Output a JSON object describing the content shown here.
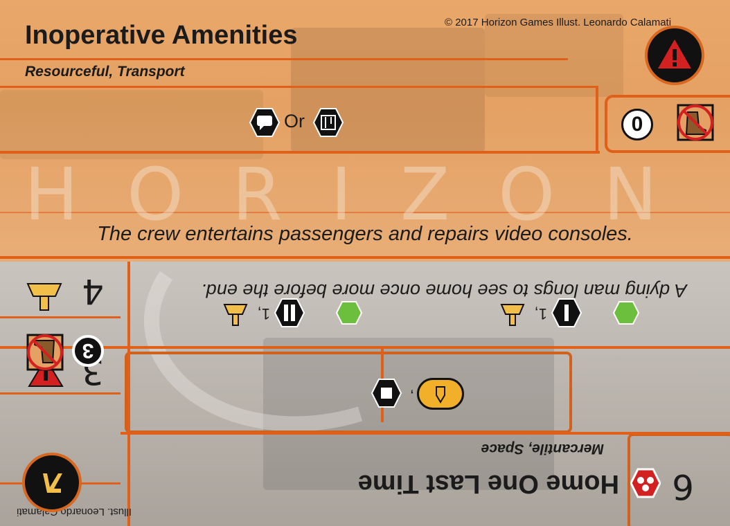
{
  "front": {
    "title": "Inoperative Amenities",
    "subtitle": "Resourceful, Transport",
    "copyright": "© 2017 Horizon Games   Illust. Leonardo Calamati",
    "or_text": "Or",
    "cost_value": "0",
    "flavor": "The crew entertains passengers and repairs video consoles.",
    "watermark": "HORIZON"
  },
  "back": {
    "title": "Home One Last Time",
    "subtitle": "Mercantile, Space",
    "illustrator": "Illust. Leonardo Calamati",
    "flavor": "A dying man longs to see home once more before the end.",
    "cost_value": "6",
    "stat_a": "4",
    "stat_b": "3",
    "stat_c": "3",
    "ability_left_value": "1,",
    "ability_right_value": "1,",
    "comma": ","
  },
  "colors": {
    "orange_top": "#e4a163",
    "accent_orange": "#e0601a",
    "grey_bottom": "#b7b1aa",
    "warning_red": "#d32020",
    "gold": "#f2c04a",
    "green_icon": "#6cbf3c"
  },
  "icons": [
    "chat-hex-icon",
    "circuit-hex-icon",
    "warning-icon",
    "no-boot-icon",
    "dome-icon",
    "star-hex-icon",
    "green-arrow-icon",
    "shield-hex-icon",
    "rocket-icon",
    "rank-icon",
    "red-hex-icon"
  ]
}
